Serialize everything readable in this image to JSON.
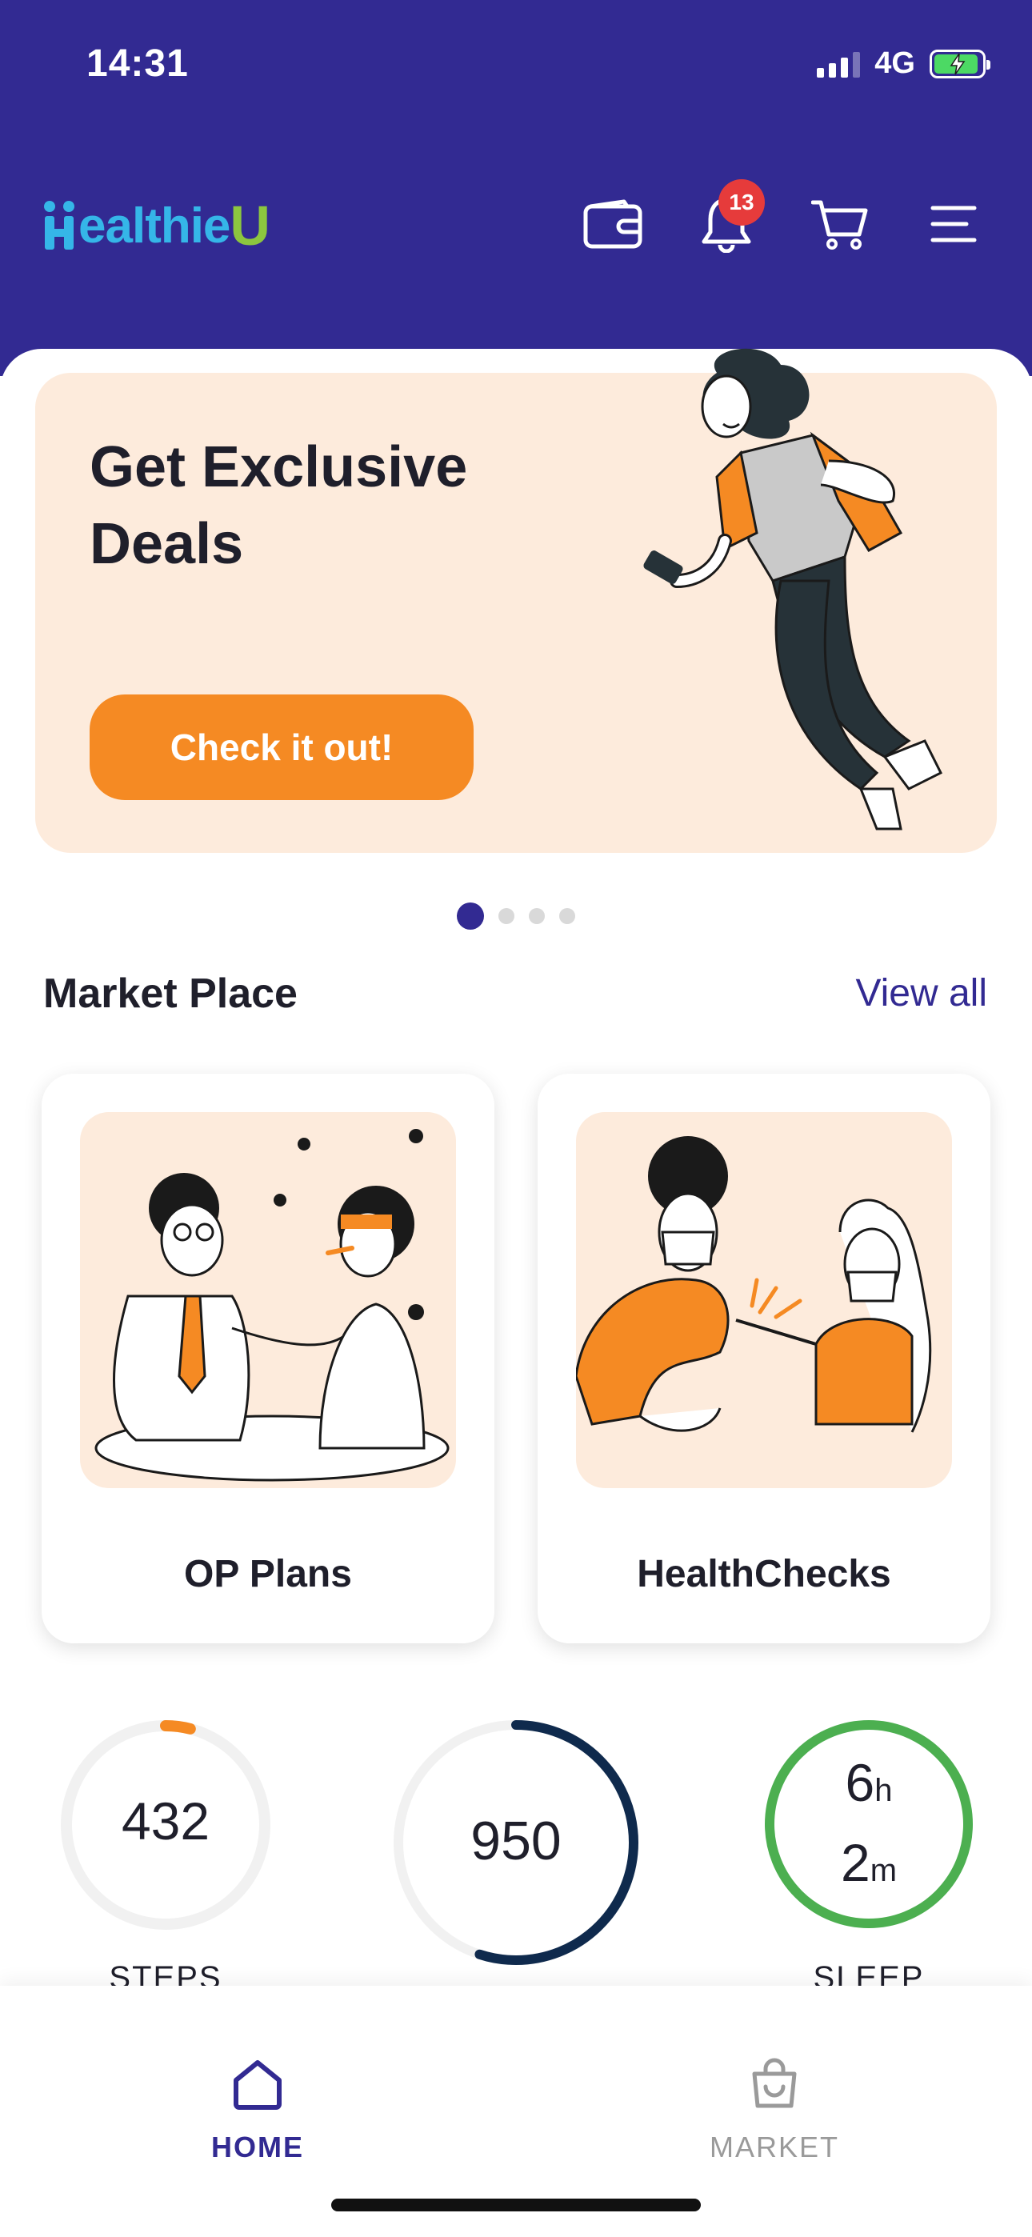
{
  "status_bar": {
    "time": "14:31",
    "network": "4G"
  },
  "header": {
    "logo_text": "HealthieU",
    "notification_count": "13",
    "icons": [
      "wallet-icon",
      "bell-icon",
      "cart-icon",
      "menu-icon"
    ]
  },
  "banner": {
    "title": "Get Exclusive Deals",
    "button_label": "Check it out!",
    "page_count": 4,
    "active_page": 1
  },
  "marketplace": {
    "title": "Market Place",
    "view_all": "View all",
    "cards": [
      {
        "label": "OP Plans"
      },
      {
        "label": "HealthChecks"
      }
    ]
  },
  "stats": {
    "steps": {
      "value": "432",
      "label": "STEPS",
      "progress": 0.04
    },
    "center": {
      "value": "950",
      "progress": 0.55
    },
    "sleep": {
      "hours": "6",
      "hours_unit": "h",
      "minutes": "2",
      "minutes_unit": "m",
      "label": "SLEEP",
      "progress": 1.0
    }
  },
  "bottom_nav": {
    "items": [
      {
        "label": "HOME",
        "active": true
      },
      {
        "label": "MARKET",
        "active": false
      }
    ]
  },
  "colors": {
    "primary": "#322a92",
    "accent_orange": "#f58a23",
    "banner_bg": "#fdebdc",
    "badge_red": "#e63b3b",
    "sleep_green": "#4caf50",
    "ring_navy": "#0f2a4d"
  }
}
